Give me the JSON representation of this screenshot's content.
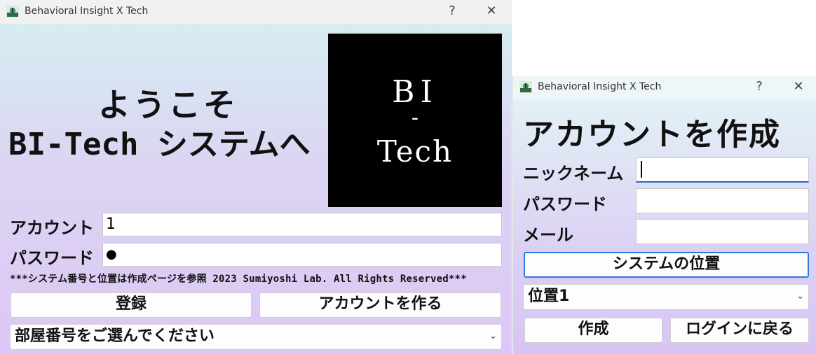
{
  "login_window": {
    "title": "Behavioral Insight X Tech",
    "help_label": "?",
    "close_label": "✕",
    "welcome_line1": "ようこそ",
    "welcome_line2": "BI-Tech システムへ",
    "logo": {
      "line1": "BI",
      "line2": "-",
      "line3": "Tech"
    },
    "account_label": "アカウント",
    "account_value": "1",
    "password_label": "パスワード",
    "password_value": "●",
    "copyright": "***システム番号と位置は作成ページを参照 2023 Sumiyoshi Lab. All Rights Reserved***",
    "register_button": "登録",
    "create_account_button": "アカウントを作る",
    "room_select_value": "部屋番号をご選んでください"
  },
  "create_window": {
    "title": "Behavioral Insight X Tech",
    "help_label": "?",
    "close_label": "✕",
    "heading": "アカウントを作成",
    "nickname_label": "ニックネーム",
    "nickname_value": "",
    "password_label": "パスワード",
    "password_value": "",
    "email_label": "メール",
    "email_value": "",
    "system_location_button": "システムの位置",
    "location_select_value": "位置1",
    "create_button": "作成",
    "back_to_login_button": "ログインに戻る"
  },
  "icons": {
    "app": "app-logo-icon",
    "dropdown": "chevron-down-icon"
  },
  "colors": {
    "focus_accent": "#1f6fc0",
    "logo_bg": "#000000"
  }
}
